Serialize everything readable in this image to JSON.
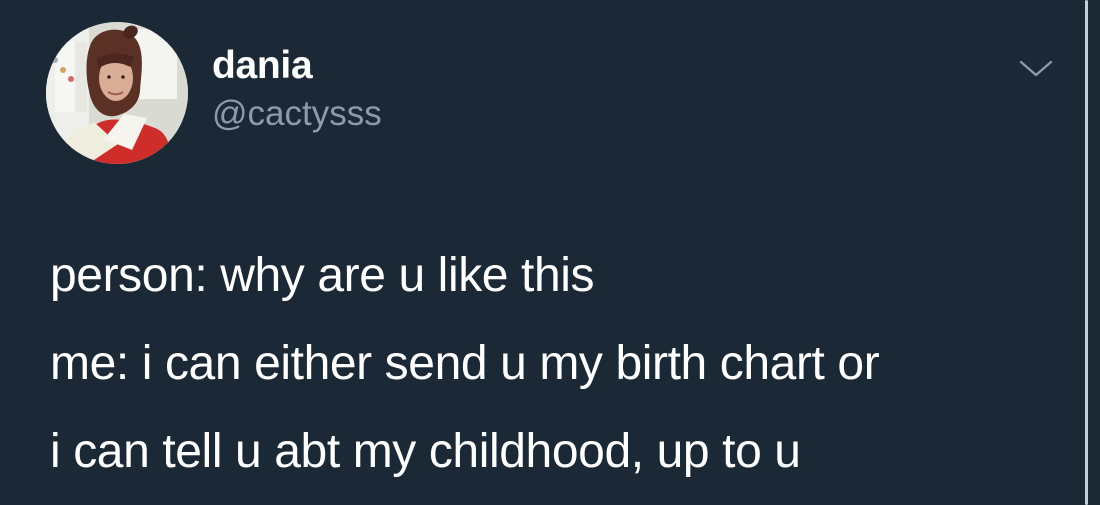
{
  "author": {
    "display_name": "dania",
    "handle": "@cactysss"
  },
  "tweet": {
    "lines": [
      "person: why are u like this",
      "me: i can either send u my birth chart or",
      "i can tell u abt my childhood, up to u"
    ]
  },
  "icons": {
    "menu": "chevron-down-icon",
    "avatar": "profile-avatar"
  },
  "colors": {
    "background": "#1b2836",
    "text_primary": "#ffffff",
    "text_secondary": "#8d9aa7",
    "chevron": "#8d9aa7"
  }
}
